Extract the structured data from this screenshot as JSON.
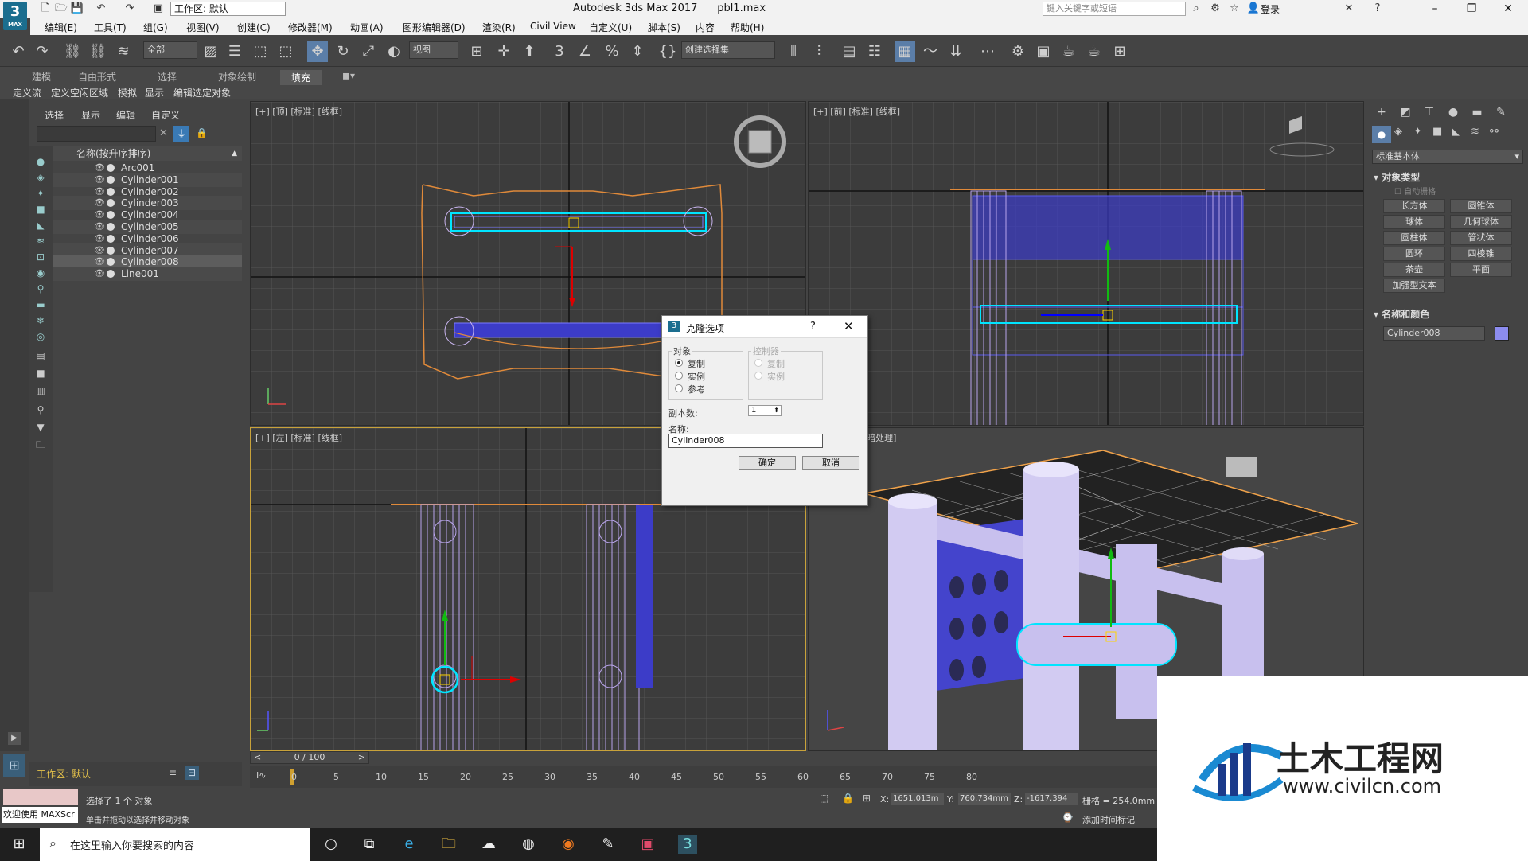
{
  "app": {
    "window_title": "Autodesk 3ds Max 2017",
    "file_name": "pbl1.max",
    "logo_text": "3",
    "logo_sub": "MAX",
    "workspace_combo": "工作区: 默认",
    "search_placeholder": "键入关键字或短语",
    "login_label": "登录"
  },
  "menu": [
    "编辑(E)",
    "工具(T)",
    "组(G)",
    "视图(V)",
    "创建(C)",
    "修改器(M)",
    "动画(A)",
    "图形编辑器(D)",
    "渲染(R)",
    "Civil View",
    "自定义(U)",
    "脚本(S)",
    "内容",
    "帮助(H)"
  ],
  "toolbar": {
    "filter_combo": "全部",
    "ref_coord_combo": "视图",
    "selection_set_combo": "创建选择集"
  },
  "ribbon": {
    "tabs": [
      "建模",
      "自由形式",
      "选择",
      "对象绘制",
      "填充"
    ],
    "active_tab": "填充",
    "subtabs": [
      "定义流",
      "定义空闲区域",
      "模拟",
      "显示",
      "编辑选定对象"
    ]
  },
  "scene_explorer": {
    "tabs": [
      "选择",
      "显示",
      "编辑",
      "自定义"
    ],
    "column_header": "名称(按升序排序)",
    "objects": [
      {
        "name": "Arc001",
        "selected": false
      },
      {
        "name": "Cylinder001",
        "selected": false
      },
      {
        "name": "Cylinder002",
        "selected": false
      },
      {
        "name": "Cylinder003",
        "selected": false
      },
      {
        "name": "Cylinder004",
        "selected": false
      },
      {
        "name": "Cylinder005",
        "selected": false
      },
      {
        "name": "Cylinder006",
        "selected": false
      },
      {
        "name": "Cylinder007",
        "selected": false
      },
      {
        "name": "Cylinder008",
        "selected": true
      },
      {
        "name": "Line001",
        "selected": false
      }
    ],
    "workspace_label": "工作区: 默认"
  },
  "viewports": {
    "top": "[+] [顶] [标准] [线框]",
    "front": "[+] [前] [标准] [线框]",
    "left": "[+] [左] [标准] [线框]",
    "perspective": "标准] [默认明暗处理]"
  },
  "dialog": {
    "title": "克隆选项",
    "help": "?",
    "object_group": "对象",
    "object_options": [
      "复制",
      "实例",
      "参考"
    ],
    "object_selected": 0,
    "controller_group": "控制器",
    "controller_options": [
      "复制",
      "实例"
    ],
    "copies_label": "副本数:",
    "copies_value": "1",
    "name_label": "名称:",
    "name_value": "Cylinder008",
    "ok": "确定",
    "cancel": "取消"
  },
  "command_panel": {
    "category_combo": "标准基本体",
    "object_type_header": "对象类型",
    "autogrid": "自动栅格",
    "buttons": [
      "长方体",
      "圆锥体",
      "球体",
      "几何球体",
      "圆柱体",
      "管状体",
      "圆环",
      "四棱锥",
      "茶壶",
      "平面",
      "加强型文本"
    ],
    "name_color_header": "名称和颜色",
    "object_name": "Cylinder008",
    "swatch_color": "#8c8cef"
  },
  "timeline": {
    "frame_display": "0 / 100",
    "ticks": [
      "0",
      "5",
      "10",
      "15",
      "20",
      "25",
      "30",
      "35",
      "40",
      "45",
      "50",
      "55",
      "60",
      "65",
      "70",
      "75",
      "80"
    ]
  },
  "status": {
    "welcome": "欢迎使用 MAXScr",
    "selection_msg": "选择了 1 个 对象",
    "hint_msg": "单击并拖动以选择并移动对象",
    "x_label": "X:",
    "x_value": "1651.013m",
    "y_label": "Y:",
    "y_value": "760.734mm",
    "z_label": "Z:",
    "z_value": "-1617.394",
    "grid": "栅格 = 254.0mm",
    "add_time_tag": "添加时间标记"
  },
  "taskbar": {
    "search_placeholder": "在这里输入你要搜索的内容"
  },
  "watermark": {
    "brand": "土木工程网",
    "url": "www.civilcn.com"
  }
}
